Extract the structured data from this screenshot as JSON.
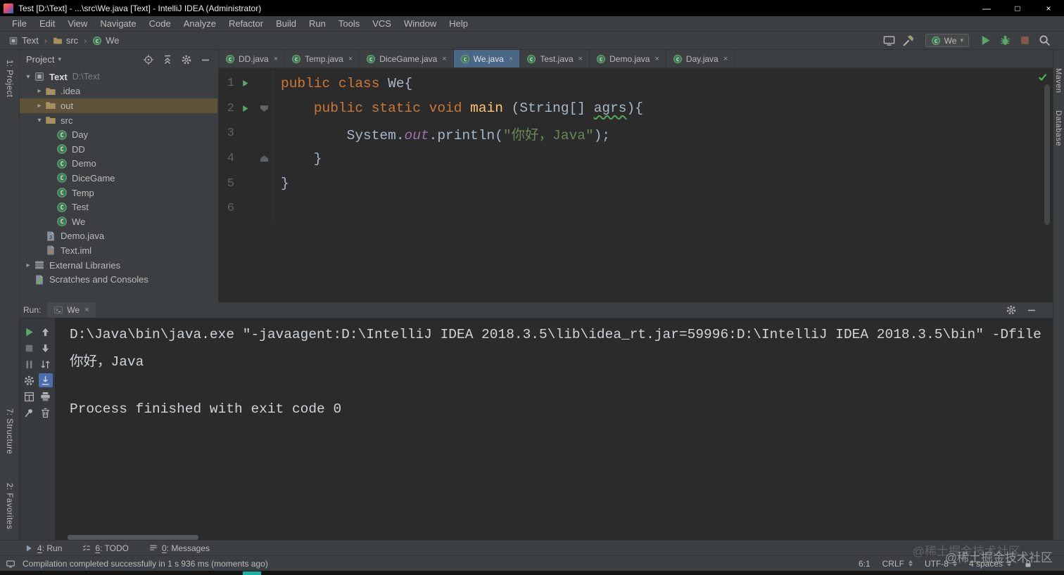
{
  "titlebar": {
    "title": "Test [D:\\Text] - ...\\src\\We.java [Text] - IntelliJ IDEA (Administrator)",
    "buttons": {
      "minimize": "—",
      "maximize": "□",
      "close": "×"
    }
  },
  "menubar": {
    "items": [
      "File",
      "Edit",
      "View",
      "Navigate",
      "Code",
      "Analyze",
      "Refactor",
      "Build",
      "Run",
      "Tools",
      "VCS",
      "Window",
      "Help"
    ]
  },
  "navbar": {
    "breadcrumb": [
      {
        "label": "Text",
        "icon": "project"
      },
      {
        "label": "src",
        "icon": "folder"
      },
      {
        "label": "We",
        "icon": "class"
      }
    ],
    "run_config": {
      "label": "We",
      "icon": "class"
    },
    "actions": [
      "toolwindow-layout",
      "build-project",
      "run",
      "debug",
      "stop",
      "search-everywhere"
    ]
  },
  "tool_stripes": {
    "project": "1: Project",
    "structure": "7: Structure",
    "favorites": "2: Favorites",
    "maven": "Maven",
    "database": "Database"
  },
  "project": {
    "header": "Project",
    "tree": [
      {
        "depth": 0,
        "arrow": "open",
        "icon": "project",
        "label": "Text",
        "sub": "D:\\Text",
        "bold": true
      },
      {
        "depth": 1,
        "arrow": "closed",
        "icon": "folder",
        "label": ".idea"
      },
      {
        "depth": 1,
        "arrow": "closed",
        "icon": "folder",
        "label": "out",
        "selected": true
      },
      {
        "depth": 1,
        "arrow": "open",
        "icon": "folder",
        "label": "src"
      },
      {
        "depth": 2,
        "arrow": "none",
        "icon": "class",
        "label": "Day"
      },
      {
        "depth": 2,
        "arrow": "none",
        "icon": "class",
        "label": "DD"
      },
      {
        "depth": 2,
        "arrow": "none",
        "icon": "class",
        "label": "Demo"
      },
      {
        "depth": 2,
        "arrow": "none",
        "icon": "class",
        "label": "DiceGame"
      },
      {
        "depth": 2,
        "arrow": "none",
        "icon": "class",
        "label": "Temp"
      },
      {
        "depth": 2,
        "arrow": "none",
        "icon": "class",
        "label": "Test"
      },
      {
        "depth": 2,
        "arrow": "none",
        "icon": "class",
        "label": "We"
      },
      {
        "depth": 1,
        "arrow": "none",
        "icon": "java-file",
        "label": "Demo.java"
      },
      {
        "depth": 1,
        "arrow": "none",
        "icon": "iml-file",
        "label": "Text.iml"
      },
      {
        "depth": 0,
        "arrow": "closed",
        "icon": "library",
        "label": "External Libraries"
      },
      {
        "depth": 0,
        "arrow": "none",
        "icon": "scratch",
        "label": "Scratches and Consoles"
      }
    ]
  },
  "editor_tabs": [
    {
      "label": "DD.java"
    },
    {
      "label": "Temp.java"
    },
    {
      "label": "DiceGame.java"
    },
    {
      "label": "We.java",
      "active": true
    },
    {
      "label": "Test.java"
    },
    {
      "label": "Demo.java"
    },
    {
      "label": "Day.java"
    }
  ],
  "editor": {
    "lines": [
      {
        "num": "1",
        "run": true,
        "fold": "",
        "segs": [
          [
            "kw",
            "public class "
          ],
          [
            "pl",
            "We{"
          ]
        ]
      },
      {
        "num": "2",
        "run": true,
        "fold": "down",
        "segs": [
          [
            "pl",
            "    "
          ],
          [
            "kw",
            "public static void "
          ],
          [
            "meth",
            "main"
          ],
          [
            "pl",
            " (String[] "
          ],
          [
            "spell",
            "agrs"
          ],
          [
            "pl",
            "){"
          ]
        ]
      },
      {
        "num": "3",
        "run": false,
        "fold": "",
        "segs": [
          [
            "pl",
            "        System."
          ],
          [
            "fld",
            "out"
          ],
          [
            "pl",
            ".println("
          ],
          [
            "str",
            "\"你好，Java\""
          ],
          [
            "pl",
            ");"
          ]
        ]
      },
      {
        "num": "4",
        "run": false,
        "fold": "up",
        "segs": [
          [
            "pl",
            "    }"
          ]
        ]
      },
      {
        "num": "5",
        "run": false,
        "fold": "",
        "segs": [
          [
            "pl",
            "}"
          ]
        ]
      },
      {
        "num": "6",
        "run": false,
        "fold": "",
        "segs": []
      }
    ]
  },
  "run_panel": {
    "label": "Run:",
    "tab": {
      "label": "We",
      "icon": "console"
    },
    "toolbar": {
      "col1": [
        {
          "name": "rerun",
          "icon": "play"
        },
        {
          "name": "stop",
          "icon": "stop"
        },
        {
          "name": "pause-output",
          "icon": "pause"
        },
        {
          "name": "run-settings",
          "icon": "gear"
        },
        {
          "name": "restore-layout",
          "icon": "layout"
        },
        {
          "name": "pin-tab",
          "icon": "pin"
        }
      ],
      "col2": [
        {
          "name": "up-the-stack-trace",
          "icon": "up"
        },
        {
          "name": "down-the-stack-trace",
          "icon": "down"
        },
        {
          "name": "soft-wrap",
          "icon": "swap"
        },
        {
          "name": "scroll-to-end",
          "icon": "scrollend",
          "selected": true
        },
        {
          "name": "print",
          "icon": "printer"
        },
        {
          "name": "clear-all",
          "icon": "trash"
        }
      ]
    },
    "console_lines": [
      "D:\\Java\\bin\\java.exe \"-javaagent:D:\\IntelliJ IDEA 2018.3.5\\lib\\idea_rt.jar=59996:D:\\IntelliJ IDEA 2018.3.5\\bin\" -Dfile",
      "你好，Java",
      "",
      "Process finished with exit code 0"
    ]
  },
  "bottom_bar": {
    "items": [
      {
        "label": "4: Run",
        "icon": "run-mini"
      },
      {
        "label": "6: TODO",
        "icon": "todo"
      },
      {
        "label": "0: Messages",
        "icon": "messages"
      }
    ]
  },
  "status_bar": {
    "message": "Compilation completed successfully in 1 s 936 ms (moments ago)",
    "right": [
      {
        "name": "caret-position",
        "label": "6:1"
      },
      {
        "name": "line-separator-select",
        "label": "CRLF",
        "caret": true
      },
      {
        "name": "encoding-select",
        "label": "UTF-8",
        "caret": true
      },
      {
        "name": "indent-select",
        "label": "4 spaces",
        "caret": true
      },
      {
        "name": "readonly-lock",
        "icon": "lock"
      }
    ]
  },
  "watermark": {
    "text": "@稀土掘金技术社区"
  },
  "colors": {
    "panel_bg": "#3C3F41",
    "editor_bg": "#2B2B2B",
    "keyword": "#CC7832",
    "string": "#6A8759",
    "method": "#FFC66B",
    "field": "#9876AA",
    "line_number": "#606366",
    "selected_row_brown": "#5E5339",
    "active_tab": "#4A6785",
    "run_green": "#59A869",
    "selected_icon_bg": "#4B6EAF"
  },
  "icons": {
    "caret_down": "▾",
    "close": "×",
    "crumb_separator": "›",
    "tree_open": "▾",
    "tree_closed": "▸",
    "play": "▶",
    "stop": "■",
    "pause": "∥",
    "gear": "⚙",
    "search": "magnifier",
    "folder": "folder",
    "class": "C-circle",
    "check": "✓",
    "lock": "padlock",
    "hammer": "build-hammer",
    "bug": "debug-bug",
    "monitor": "monitor",
    "trash": "trash-can",
    "printer": "printer",
    "pin": "pushpin",
    "up": "↑",
    "down": "↓"
  }
}
